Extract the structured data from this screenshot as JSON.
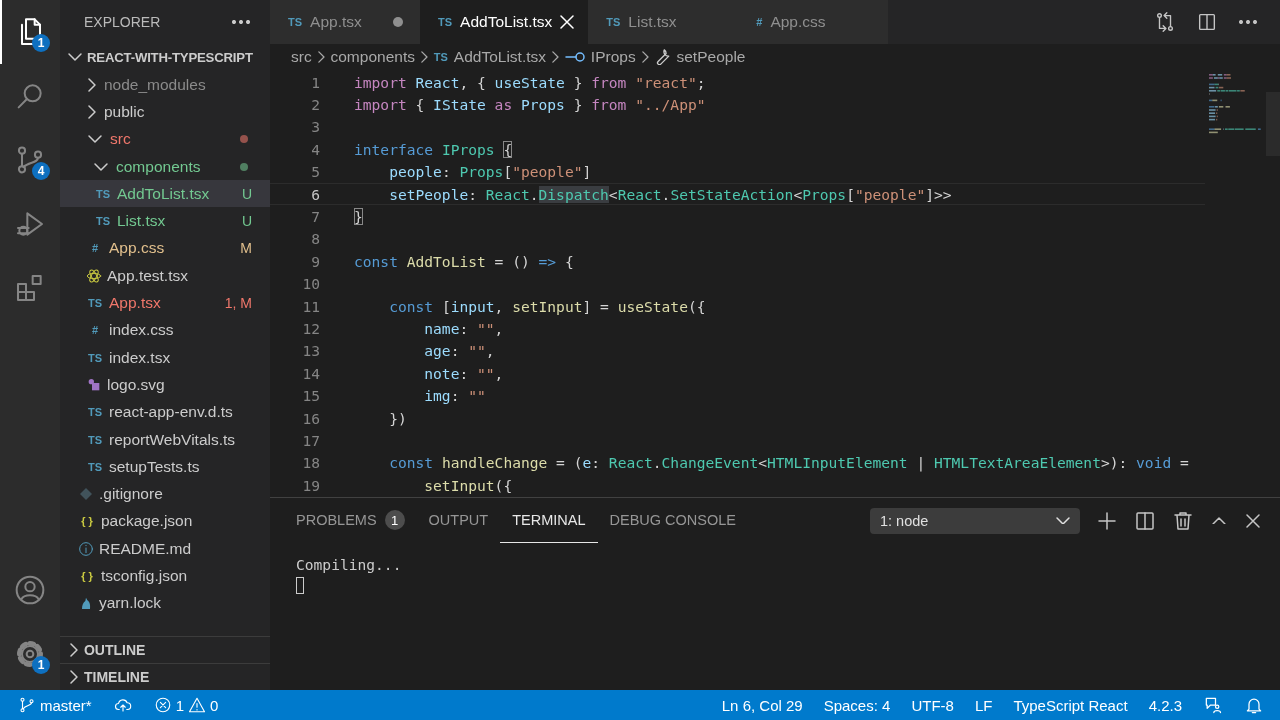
{
  "activity_bar": {
    "items": [
      {
        "selected": true,
        "badge": "1"
      },
      {
        "selected": false
      },
      {
        "selected": false,
        "badge": "4"
      },
      {
        "selected": false
      },
      {
        "selected": false
      }
    ],
    "bottom_items": [
      {
        "selected": false
      },
      {
        "selected": false,
        "badge": "1"
      }
    ]
  },
  "sidebar": {
    "title": "EXPLORER",
    "project": {
      "label": "REACT-WITH-TYPESCRIPT",
      "expanded": true,
      "children": [
        {
          "label": "node_modules",
          "kind": "folder",
          "expanded": false,
          "color": "#8b8b8b",
          "selected": false
        },
        {
          "label": "public",
          "kind": "folder",
          "expanded": false,
          "selected": false
        },
        {
          "label": "src",
          "kind": "folder",
          "expanded": true,
          "color": "#f0776b",
          "dot": true,
          "selected": false,
          "children": [
            {
              "label": "components",
              "kind": "folder",
              "expanded": true,
              "color": "#73c991",
              "dot": true,
              "selected": false,
              "children": [
                {
                  "label": "AddToList.tsx",
                  "kind": "glyph",
                  "glyph": "TS",
                  "color": "#73c991",
                  "decoration": "U",
                  "selected": true
                },
                {
                  "label": "List.tsx",
                  "kind": "glyph",
                  "glyph": "TS",
                  "color": "#73c991",
                  "decoration": "U",
                  "selected": false
                }
              ]
            },
            {
              "label": "App.css",
              "kind": "glyph",
              "glyph": "#",
              "color": "#e2c08d",
              "decoration": "M",
              "selected": false
            },
            {
              "label": "App.test.tsx",
              "kind": "react",
              "selected": false
            },
            {
              "label": "App.tsx",
              "kind": "glyph",
              "glyph": "TS",
              "color": "#f0776b",
              "decoration": "1, M",
              "selected": false
            },
            {
              "label": "index.css",
              "kind": "glyph",
              "glyph": "#",
              "selected": false
            },
            {
              "label": "index.tsx",
              "kind": "glyph",
              "glyph": "TS",
              "selected": false
            },
            {
              "label": "logo.svg",
              "kind": "svg",
              "selected": false
            },
            {
              "label": "react-app-env.d.ts",
              "kind": "glyph",
              "glyph": "TS",
              "selected": false
            },
            {
              "label": "reportWebVitals.ts",
              "kind": "glyph",
              "glyph": "TS",
              "selected": false
            },
            {
              "label": "setupTests.ts",
              "kind": "glyph",
              "glyph": "TS",
              "selected": false
            }
          ]
        },
        {
          "label": ".gitignore",
          "kind": "git",
          "selected": false
        },
        {
          "label": "package.json",
          "kind": "glyph",
          "glyph": "{ }",
          "selected": false
        },
        {
          "label": "README.md",
          "kind": "info",
          "selected": false
        },
        {
          "label": "tsconfig.json",
          "kind": "glyph",
          "glyph": "{ }",
          "selected": false
        },
        {
          "label": "yarn.lock",
          "kind": "yarn",
          "selected": false
        }
      ]
    },
    "sections": [
      {
        "label": "OUTLINE",
        "expanded": false
      },
      {
        "label": "TIMELINE",
        "expanded": false
      }
    ]
  },
  "tabs": [
    {
      "glyph": "TS",
      "label": "App.tsx",
      "selected": false,
      "modified": true
    },
    {
      "glyph": "TS",
      "label": "AddToList.tsx",
      "selected": true,
      "modified": false
    },
    {
      "glyph": "TS",
      "label": "List.tsx",
      "selected": false,
      "modified": false
    },
    {
      "glyph": "#",
      "label": "App.css",
      "selected": false,
      "modified": false
    }
  ],
  "breadcrumbs": [
    {
      "label": "src",
      "kind": "folder"
    },
    {
      "label": "components",
      "kind": "folder"
    },
    {
      "label": "AddToList.tsx",
      "kind": "file",
      "glyph": "TS"
    },
    {
      "label": "IProps",
      "kind": "interface"
    },
    {
      "label": "setPeople",
      "kind": "property"
    }
  ],
  "code": [
    {
      "n": "1",
      "current": false,
      "tokens": [
        {
          "text": "import ",
          "kind": "kw"
        },
        {
          "text": "React",
          "kind": "var"
        },
        {
          "text": ", { ",
          "kind": "p"
        },
        {
          "text": "useState",
          "kind": "var"
        },
        {
          "text": " } ",
          "kind": "p"
        },
        {
          "text": "from ",
          "kind": "kw"
        },
        {
          "text": "\"react\"",
          "kind": "str"
        },
        {
          "text": ";",
          "kind": "p"
        }
      ]
    },
    {
      "n": "2",
      "current": false,
      "tokens": [
        {
          "text": "import ",
          "kind": "kw"
        },
        {
          "text": "{ ",
          "kind": "p"
        },
        {
          "text": "IState ",
          "kind": "var"
        },
        {
          "text": "as ",
          "kind": "kw"
        },
        {
          "text": "Props ",
          "kind": "var"
        },
        {
          "text": "} ",
          "kind": "p"
        },
        {
          "text": "from ",
          "kind": "kw"
        },
        {
          "text": "\"../App\"",
          "kind": "str"
        }
      ]
    },
    {
      "n": "3",
      "current": false
    },
    {
      "n": "4",
      "current": false,
      "tokens": [
        {
          "text": "interface ",
          "kind": "dec"
        },
        {
          "text": "IProps ",
          "kind": "type"
        },
        {
          "text": "{",
          "kind": "brace_match"
        }
      ]
    },
    {
      "n": "5",
      "current": false,
      "tokens": [
        {
          "text": "    people",
          "kind": "var"
        },
        {
          "text": ": ",
          "kind": "p"
        },
        {
          "text": "Props",
          "kind": "type"
        },
        {
          "text": "[",
          "kind": "p"
        },
        {
          "text": "\"people\"",
          "kind": "str"
        },
        {
          "text": "]",
          "kind": "p"
        }
      ]
    },
    {
      "n": "6",
      "current": true,
      "tokens": [
        {
          "text": "    setPeople",
          "kind": "var"
        },
        {
          "text": ": ",
          "kind": "p"
        },
        {
          "text": "React",
          "kind": "type"
        },
        {
          "text": ".",
          "kind": "p"
        },
        {
          "text": "Dispatch",
          "kind": "type_hl"
        },
        {
          "text": "<",
          "kind": "p"
        },
        {
          "text": "React",
          "kind": "type"
        },
        {
          "text": ".",
          "kind": "p"
        },
        {
          "text": "SetStateAction",
          "kind": "type"
        },
        {
          "text": "<",
          "kind": "p"
        },
        {
          "text": "Props",
          "kind": "type"
        },
        {
          "text": "[",
          "kind": "p"
        },
        {
          "text": "\"people\"",
          "kind": "str"
        },
        {
          "text": "]>>",
          "kind": "p"
        }
      ]
    },
    {
      "n": "7",
      "current": false,
      "tokens": [
        {
          "text": "}",
          "kind": "brace_match"
        }
      ]
    },
    {
      "n": "8",
      "current": false
    },
    {
      "n": "9",
      "current": false,
      "tokens": [
        {
          "text": "const ",
          "kind": "dec"
        },
        {
          "text": "AddToList",
          "kind": "fn"
        },
        {
          "text": " = () ",
          "kind": "p"
        },
        {
          "text": "=>",
          "kind": "dec"
        },
        {
          "text": " {",
          "kind": "p"
        }
      ]
    },
    {
      "n": "10",
      "current": false
    },
    {
      "n": "11",
      "current": false,
      "tokens": [
        {
          "text": "    const ",
          "kind": "dec"
        },
        {
          "text": "[",
          "kind": "p"
        },
        {
          "text": "input",
          "kind": "var"
        },
        {
          "text": ", ",
          "kind": "p"
        },
        {
          "text": "setInput",
          "kind": "fn"
        },
        {
          "text": "] = ",
          "kind": "p"
        },
        {
          "text": "useState",
          "kind": "fn"
        },
        {
          "text": "({",
          "kind": "p"
        }
      ]
    },
    {
      "n": "12",
      "current": false,
      "tokens": [
        {
          "text": "        name",
          "kind": "var"
        },
        {
          "text": ": ",
          "kind": "p"
        },
        {
          "text": "\"\"",
          "kind": "str"
        },
        {
          "text": ",",
          "kind": "p"
        }
      ]
    },
    {
      "n": "13",
      "current": false,
      "tokens": [
        {
          "text": "        age",
          "kind": "var"
        },
        {
          "text": ": ",
          "kind": "p"
        },
        {
          "text": "\"\"",
          "kind": "str"
        },
        {
          "text": ",",
          "kind": "p"
        }
      ]
    },
    {
      "n": "14",
      "current": false,
      "tokens": [
        {
          "text": "        note",
          "kind": "var"
        },
        {
          "text": ": ",
          "kind": "p"
        },
        {
          "text": "\"\"",
          "kind": "str"
        },
        {
          "text": ",",
          "kind": "p"
        }
      ]
    },
    {
      "n": "15",
      "current": false,
      "tokens": [
        {
          "text": "        img",
          "kind": "var"
        },
        {
          "text": ": ",
          "kind": "p"
        },
        {
          "text": "\"\"",
          "kind": "str"
        }
      ]
    },
    {
      "n": "16",
      "current": false,
      "tokens": [
        {
          "text": "    })",
          "kind": "p"
        }
      ]
    },
    {
      "n": "17",
      "current": false
    },
    {
      "n": "18",
      "current": false,
      "tokens": [
        {
          "text": "    const ",
          "kind": "dec"
        },
        {
          "text": "handleChange",
          "kind": "fn"
        },
        {
          "text": " = (",
          "kind": "p"
        },
        {
          "text": "e",
          "kind": "var"
        },
        {
          "text": ": ",
          "kind": "p"
        },
        {
          "text": "React",
          "kind": "type"
        },
        {
          "text": ".",
          "kind": "p"
        },
        {
          "text": "ChangeEvent",
          "kind": "type"
        },
        {
          "text": "<",
          "kind": "p"
        },
        {
          "text": "HTMLInputElement",
          "kind": "type"
        },
        {
          "text": " | ",
          "kind": "p"
        },
        {
          "text": "HTMLTextAreaElement",
          "kind": "type"
        },
        {
          "text": ">): ",
          "kind": "p"
        },
        {
          "text": "void ",
          "kind": "dec"
        },
        {
          "text": "=",
          "kind": "p"
        }
      ]
    },
    {
      "n": "19",
      "current": false,
      "tokens": [
        {
          "text": "        setInput",
          "kind": "fn"
        },
        {
          "text": "({",
          "kind": "p"
        }
      ]
    }
  ],
  "panel": {
    "tabs": [
      {
        "label": "PROBLEMS",
        "selected": false,
        "badge": "1"
      },
      {
        "label": "OUTPUT",
        "selected": false
      },
      {
        "label": "TERMINAL",
        "selected": true
      },
      {
        "label": "DEBUG CONSOLE",
        "selected": false
      }
    ],
    "terminal_select": "1: node",
    "terminal_lines": [
      "Compiling..."
    ]
  },
  "status_bar": {
    "branch": "master*",
    "errors": "1",
    "warnings": "0",
    "items": [
      "Ln 6, Col 29",
      "Spaces: 4",
      "UTF-8",
      "LF",
      "TypeScript React",
      "4.2.3"
    ]
  }
}
